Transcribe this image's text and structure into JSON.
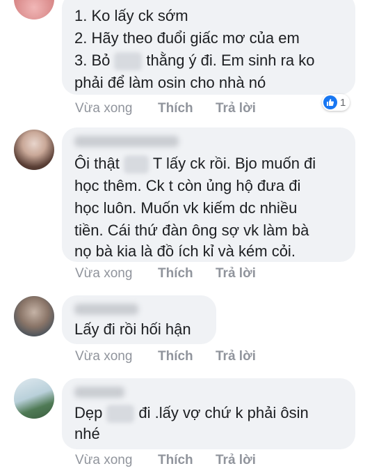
{
  "comments": [
    {
      "lines": [
        "1. Ko lấy ck sớm",
        "2. Hãy theo đuổi giấc mơ của em",
        "3. Bỏ",
        "thằng ý đi. Em sinh ra ko",
        "phải để làm osin cho nhà nó"
      ],
      "time": "Vừa xong",
      "like": "Thích",
      "reply": "Trả lời",
      "reaction_count": "1"
    },
    {
      "lines": [
        "Ôi thật",
        "T lấy ck rồi. Bjo muốn đi",
        "học thêm. Ck t còn ủng hộ đưa đi",
        "học luôn. Muốn vk kiếm dc nhiều",
        "tiền. Cái thứ đàn ông sợ vk làm bà",
        "nọ bà kia là đồ ích kỉ và kém cỏi."
      ],
      "time": "Vừa xong",
      "like": "Thích",
      "reply": "Trả lời"
    },
    {
      "lines": [
        "Lấy đi rồi hối hận"
      ],
      "time": "Vừa xong",
      "like": "Thích",
      "reply": "Trả lời"
    },
    {
      "lines": [
        "Dẹp",
        "đi .lấy vợ chứ k phải ôsin",
        "nhé"
      ],
      "time": "Vừa xong",
      "like": "Thích",
      "reply": "Trả lời"
    }
  ],
  "colors": {
    "bubble": "#f0f2f5",
    "meta": "#90949c",
    "like_blue": "#1877f2"
  },
  "icons": {
    "reaction": "like-thumb-icon"
  }
}
